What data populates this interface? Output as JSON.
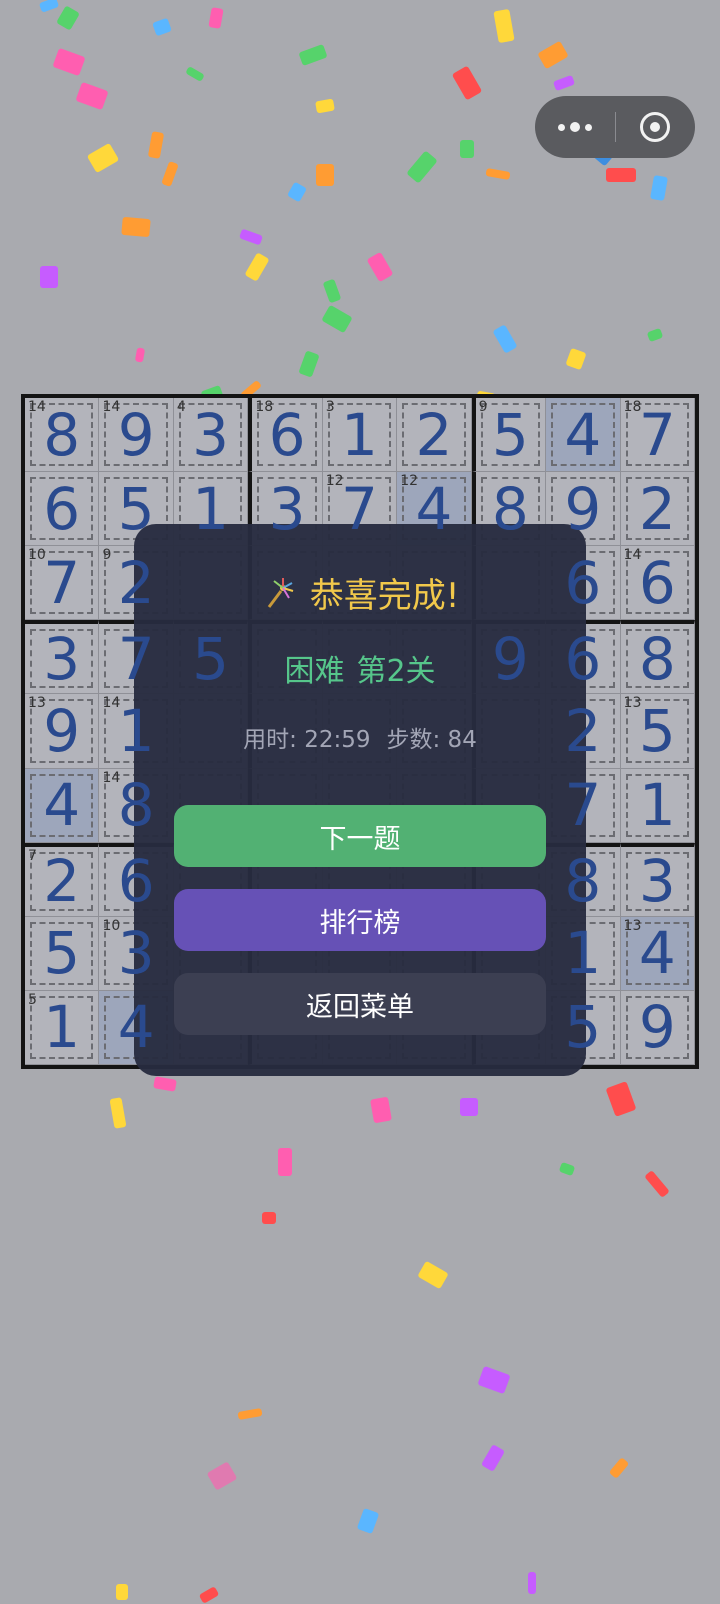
{
  "capsule": {
    "more_icon": "more-dots-icon",
    "close_icon": "target-circle-icon"
  },
  "board": {
    "rows": [
      [
        {
          "v": "8",
          "s": "14"
        },
        {
          "v": "9",
          "s": "14"
        },
        {
          "v": "3",
          "s": "4"
        },
        {
          "v": "6",
          "s": "18"
        },
        {
          "v": "1",
          "s": "3"
        },
        {
          "v": "2",
          "s": ""
        },
        {
          "v": "5",
          "s": "9"
        },
        {
          "v": "4",
          "s": "",
          "hl": true
        },
        {
          "v": "7",
          "s": "18"
        }
      ],
      [
        {
          "v": "6",
          "s": ""
        },
        {
          "v": "5",
          "s": ""
        },
        {
          "v": "1",
          "s": ""
        },
        {
          "v": "3",
          "s": ""
        },
        {
          "v": "7",
          "s": "12"
        },
        {
          "v": "4",
          "s": "12",
          "hl": true
        },
        {
          "v": "8",
          "s": ""
        },
        {
          "v": "9",
          "s": ""
        },
        {
          "v": "2",
          "s": ""
        }
      ],
      [
        {
          "v": "7",
          "s": "10"
        },
        {
          "v": "2",
          "s": "9"
        },
        {
          "v": "",
          "s": ""
        },
        {
          "v": "",
          "s": ""
        },
        {
          "v": "",
          "s": ""
        },
        {
          "v": "",
          "s": ""
        },
        {
          "v": "",
          "s": ""
        },
        {
          "v": "6",
          "s": ""
        },
        {
          "v": "6",
          "s": "14"
        }
      ],
      [
        {
          "v": "3",
          "s": ""
        },
        {
          "v": "7",
          "s": ""
        },
        {
          "v": "5",
          "s": ""
        },
        {
          "v": "",
          "s": ""
        },
        {
          "v": "",
          "s": ""
        },
        {
          "v": "",
          "s": ""
        },
        {
          "v": "9",
          "s": ""
        },
        {
          "v": "6",
          "s": ""
        },
        {
          "v": "8",
          "s": ""
        }
      ],
      [
        {
          "v": "9",
          "s": "13"
        },
        {
          "v": "1",
          "s": "14"
        },
        {
          "v": "",
          "s": ""
        },
        {
          "v": "",
          "s": ""
        },
        {
          "v": "",
          "s": ""
        },
        {
          "v": "",
          "s": ""
        },
        {
          "v": "",
          "s": ""
        },
        {
          "v": "2",
          "s": ""
        },
        {
          "v": "5",
          "s": "13"
        }
      ],
      [
        {
          "v": "4",
          "s": "",
          "hl": true
        },
        {
          "v": "8",
          "s": "14"
        },
        {
          "v": "",
          "s": ""
        },
        {
          "v": "",
          "s": ""
        },
        {
          "v": "",
          "s": ""
        },
        {
          "v": "",
          "s": ""
        },
        {
          "v": "",
          "s": ""
        },
        {
          "v": "7",
          "s": ""
        },
        {
          "v": "1",
          "s": ""
        }
      ],
      [
        {
          "v": "2",
          "s": "7"
        },
        {
          "v": "6",
          "s": ""
        },
        {
          "v": "",
          "s": ""
        },
        {
          "v": "",
          "s": ""
        },
        {
          "v": "",
          "s": ""
        },
        {
          "v": "",
          "s": ""
        },
        {
          "v": "",
          "s": ""
        },
        {
          "v": "8",
          "s": ""
        },
        {
          "v": "3",
          "s": ""
        }
      ],
      [
        {
          "v": "5",
          "s": ""
        },
        {
          "v": "3",
          "s": "10"
        },
        {
          "v": "",
          "s": ""
        },
        {
          "v": "",
          "s": ""
        },
        {
          "v": "",
          "s": ""
        },
        {
          "v": "",
          "s": ""
        },
        {
          "v": "",
          "s": ""
        },
        {
          "v": "1",
          "s": ""
        },
        {
          "v": "4",
          "s": "13",
          "hl": true
        }
      ],
      [
        {
          "v": "1",
          "s": "5"
        },
        {
          "v": "4",
          "s": "",
          "hl": true
        },
        {
          "v": "",
          "s": ""
        },
        {
          "v": "",
          "s": ""
        },
        {
          "v": "",
          "s": ""
        },
        {
          "v": "",
          "s": ""
        },
        {
          "v": "",
          "s": ""
        },
        {
          "v": "5",
          "s": ""
        },
        {
          "v": "9",
          "s": ""
        }
      ]
    ]
  },
  "modal": {
    "title_icon": "firework-icon",
    "title": "恭喜完成!",
    "difficulty": "困难",
    "level": "第2关",
    "time_label": "用时: 22:59",
    "steps_label": "步数: 84",
    "next_button": "下一题",
    "rank_button": "排行榜",
    "menu_button": "返回菜单"
  },
  "colors": {
    "background": "#a9aaaf",
    "modal_bg": "#282c40",
    "title": "#f1c84b",
    "level": "#56c68b",
    "next": "#52b173",
    "rank": "#6651b6",
    "menu": "#3c3f52",
    "digit": "#2a4a8e"
  }
}
